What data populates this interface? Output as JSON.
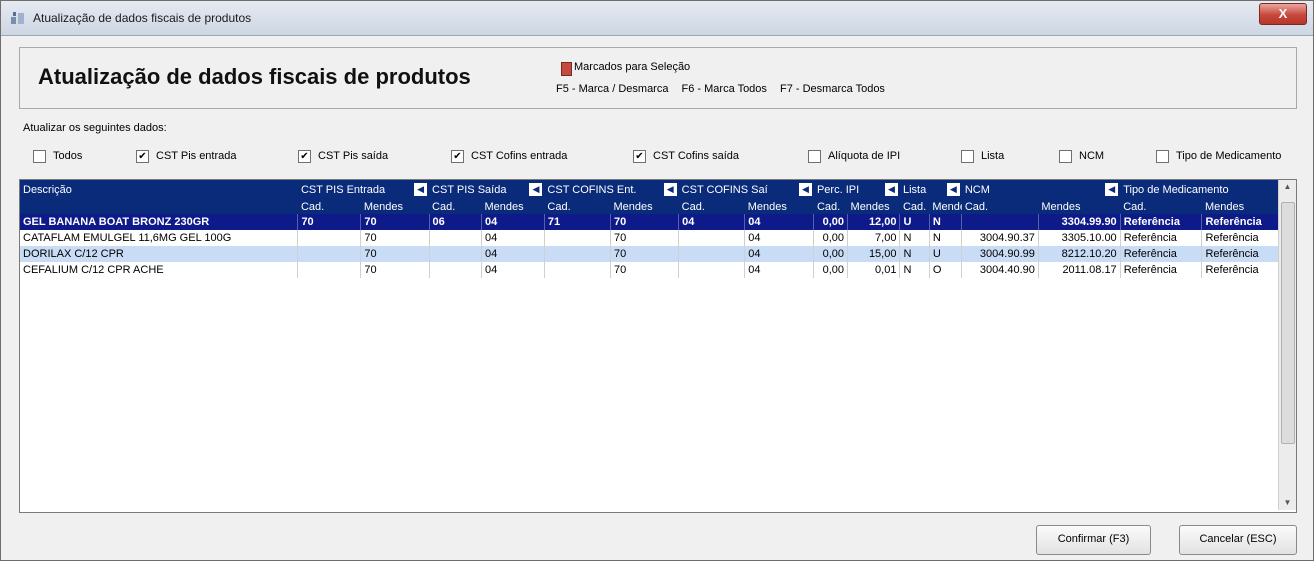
{
  "window": {
    "title": "Atualização de dados fiscais de produtos",
    "close_label": "X"
  },
  "header": {
    "title": "Atualização de dados fiscais de produtos",
    "legend": "Marcados para Seleção",
    "keys": [
      "F5 - Marca / Desmarca",
      "F6 - Marca Todos",
      "F7 - Desmarca Todos"
    ]
  },
  "options": {
    "label": "Atualizar os seguintes dados:",
    "items": [
      {
        "label": "Todos",
        "checked": false
      },
      {
        "label": "CST Pis entrada",
        "checked": true
      },
      {
        "label": "CST Pis saída",
        "checked": true
      },
      {
        "label": "CST Cofins entrada",
        "checked": true
      },
      {
        "label": "CST Cofins saída",
        "checked": true
      },
      {
        "label": "Alíquota de IPI",
        "checked": false
      },
      {
        "label": "Lista",
        "checked": false
      },
      {
        "label": "NCM",
        "checked": false
      },
      {
        "label": "Tipo de Medicamento",
        "checked": false
      }
    ]
  },
  "grid": {
    "groups": [
      "Descrição",
      "CST PIS Entrada",
      "CST PIS Saída",
      "CST COFINS Ent.",
      "CST COFINS Saí",
      "Perc. IPI",
      "Lista",
      "NCM",
      "Tipo de Medicamento"
    ],
    "sub": [
      "Cad.",
      "Mendes"
    ],
    "rows": [
      [
        "GEL BANANA BOAT BRONZ 230GR",
        "70",
        "70",
        "06",
        "04",
        "71",
        "70",
        "04",
        "04",
        "0,00",
        "12,00",
        "U",
        "N",
        "",
        "3304.99.90",
        "Referência",
        "Referência"
      ],
      [
        "CATAFLAM EMULGEL 11,6MG GEL 100G",
        "",
        "70",
        "",
        "04",
        "",
        "70",
        "",
        "04",
        "0,00",
        "7,00",
        "N",
        "N",
        "3004.90.37",
        "3305.10.00",
        "Referência",
        "Referência"
      ],
      [
        "DORILAX C/12 CPR",
        "",
        "70",
        "",
        "04",
        "",
        "70",
        "",
        "04",
        "0,00",
        "15,00",
        "N",
        "U",
        "3004.90.99",
        "8212.10.20",
        "Referência",
        "Referência"
      ],
      [
        "CEFALIUM C/12 CPR ACHE",
        "",
        "70",
        "",
        "04",
        "",
        "70",
        "",
        "04",
        "0,00",
        "0,01",
        "N",
        "O",
        "3004.40.90",
        "2011.08.17",
        "Referência",
        "Referência"
      ]
    ]
  },
  "buttons": {
    "confirm": "Confirmar (F3)",
    "cancel": "Cancelar (ESC)"
  }
}
